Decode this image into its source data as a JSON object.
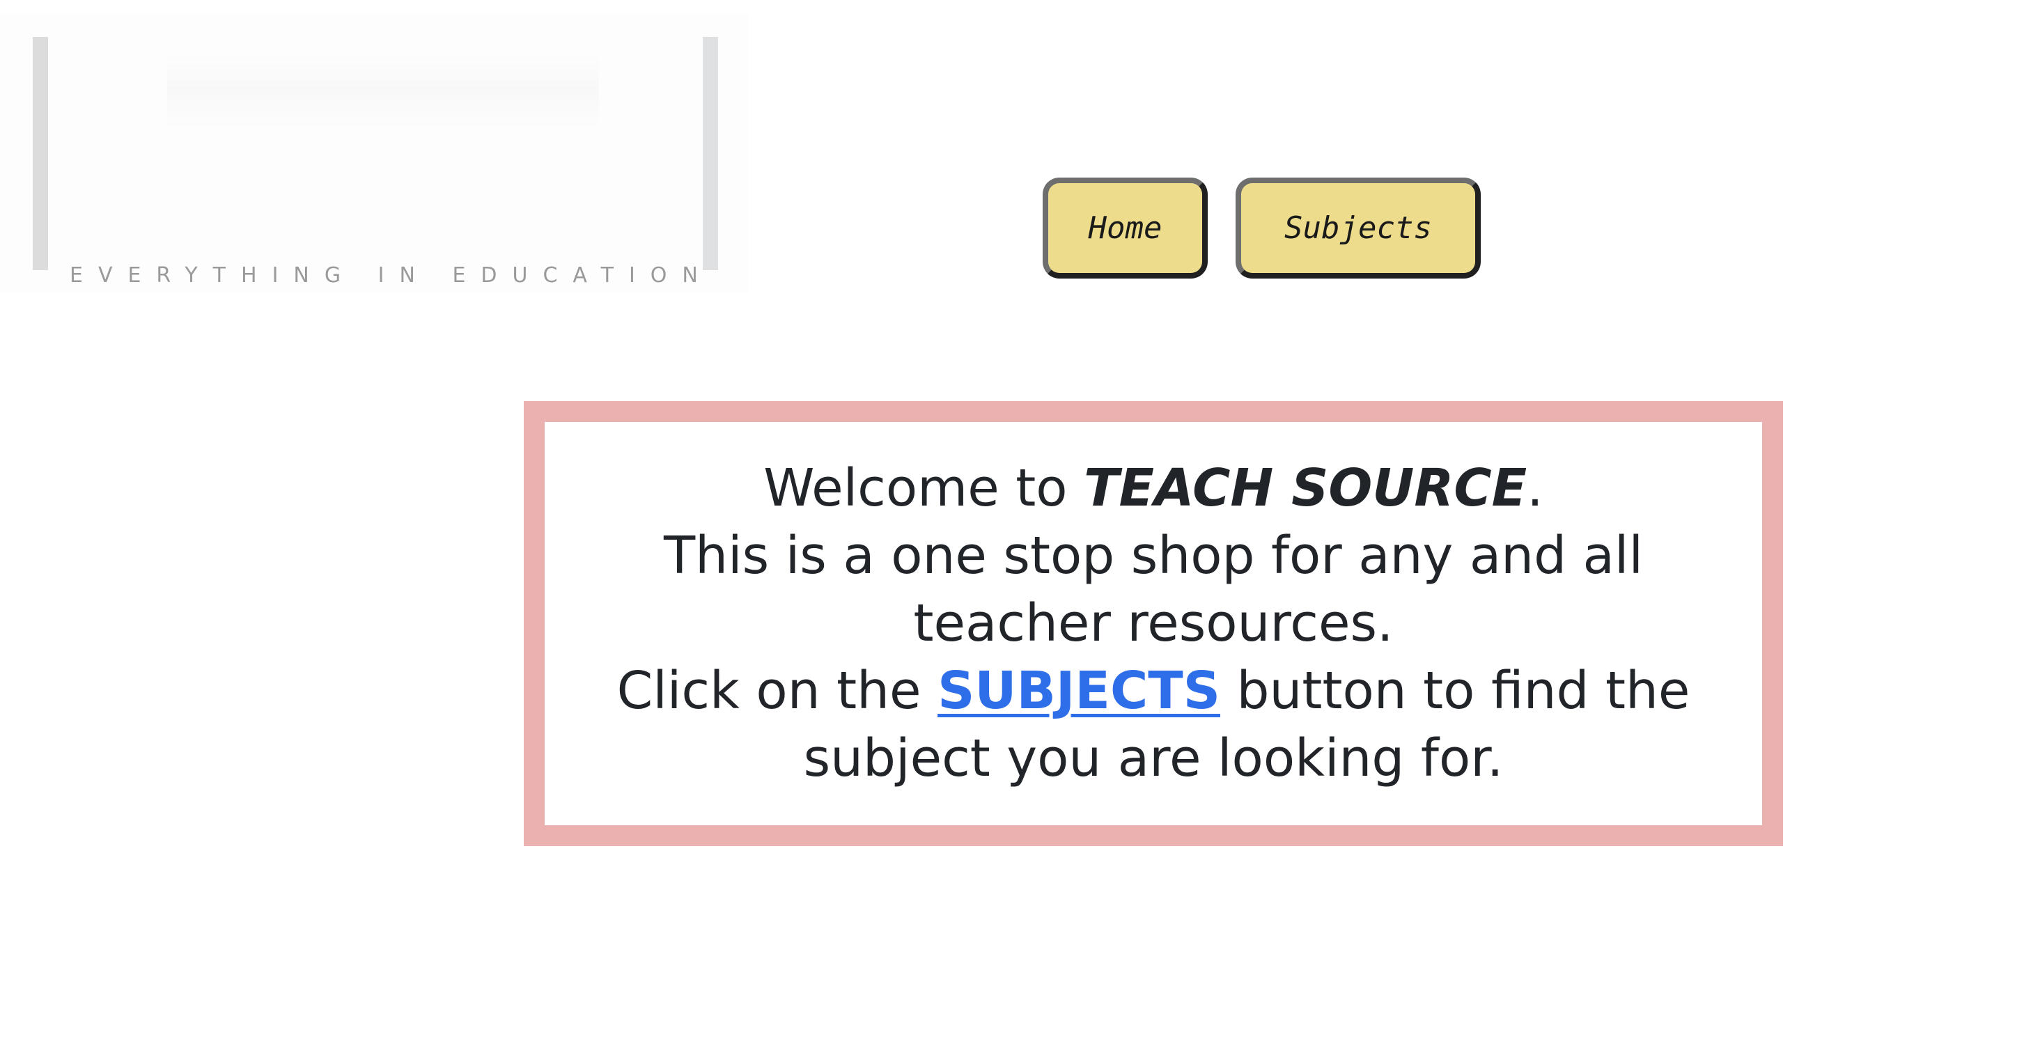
{
  "logo": {
    "tagline": "EVERYTHING IN EDUCATION"
  },
  "nav": {
    "home_label": "Home",
    "subjects_label": "Subjects"
  },
  "welcome": {
    "line1_prefix": "Welcome to ",
    "brand_name": "TEACH SOURCE",
    "line1_suffix": ".",
    "line2": "This is a one stop shop for any and all teacher resources.",
    "line3_prefix": "Click on the ",
    "subjects_link": "SUBJECTS",
    "line3_suffix": " button to find the subject you are looking for."
  },
  "colors": {
    "button_bg": "#ecdc8b",
    "card_border": "#ebb0b0",
    "link": "#2e6ee8",
    "text": "#212529",
    "tagline": "#9a9a9a"
  }
}
